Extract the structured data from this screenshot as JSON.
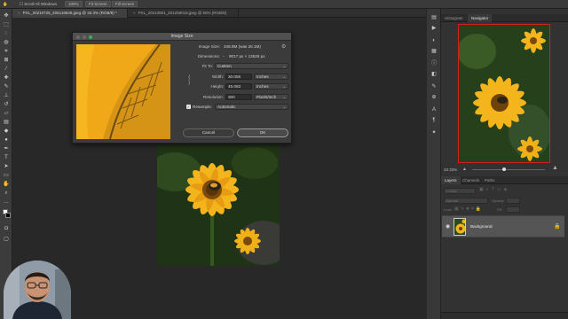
{
  "options_bar": {
    "scroll_all_windows": "Scroll All Windows",
    "zoom": "100%",
    "fit_screen": "Fit Screen",
    "fill_screen": "Fill Screen"
  },
  "tabs": [
    {
      "label": "PXL_20210725_205116846.jpeg @ 33.3% (RGB/8) *",
      "close": "×"
    },
    {
      "label": "PXL_20210801_201258019.jpeg @ 50% (RGB/8)",
      "close": "×"
    }
  ],
  "dialog": {
    "title": "Image Size",
    "image_size_label": "Image Size:",
    "image_size_value": "348.8M (was 20.1M)",
    "dimensions_label": "Dimensions:",
    "dimensions_value": "9017 px × 13525 px",
    "fit_to_label": "Fit To:",
    "fit_to_value": "Custom",
    "width_label": "Width:",
    "width_value": "30.056",
    "width_unit": "Inches",
    "height_label": "Height:",
    "height_value": "45.083",
    "height_unit": "Inches",
    "resolution_label": "Resolution:",
    "resolution_value": "300",
    "resolution_unit": "Pixels/Inch",
    "resample_label": "Resample:",
    "resample_value": "Automatic",
    "cancel": "Cancel",
    "ok": "OK"
  },
  "right_panel": {
    "tabs": [
      "Histogram",
      "Navigator"
    ],
    "zoom": "33.33%",
    "layers_tabs": [
      "Layers",
      "Channels",
      "Paths"
    ],
    "kind_placeholder": "Kind",
    "blend_mode": "Normal",
    "opacity_label": "Opacity:",
    "lock_label": "Lock:",
    "fill_label": "Fill:",
    "layer_name": "Background"
  },
  "colors": {
    "accent_red": "#d12020",
    "petal": "#f2b11c",
    "ok_button": "#4a4a4a"
  }
}
